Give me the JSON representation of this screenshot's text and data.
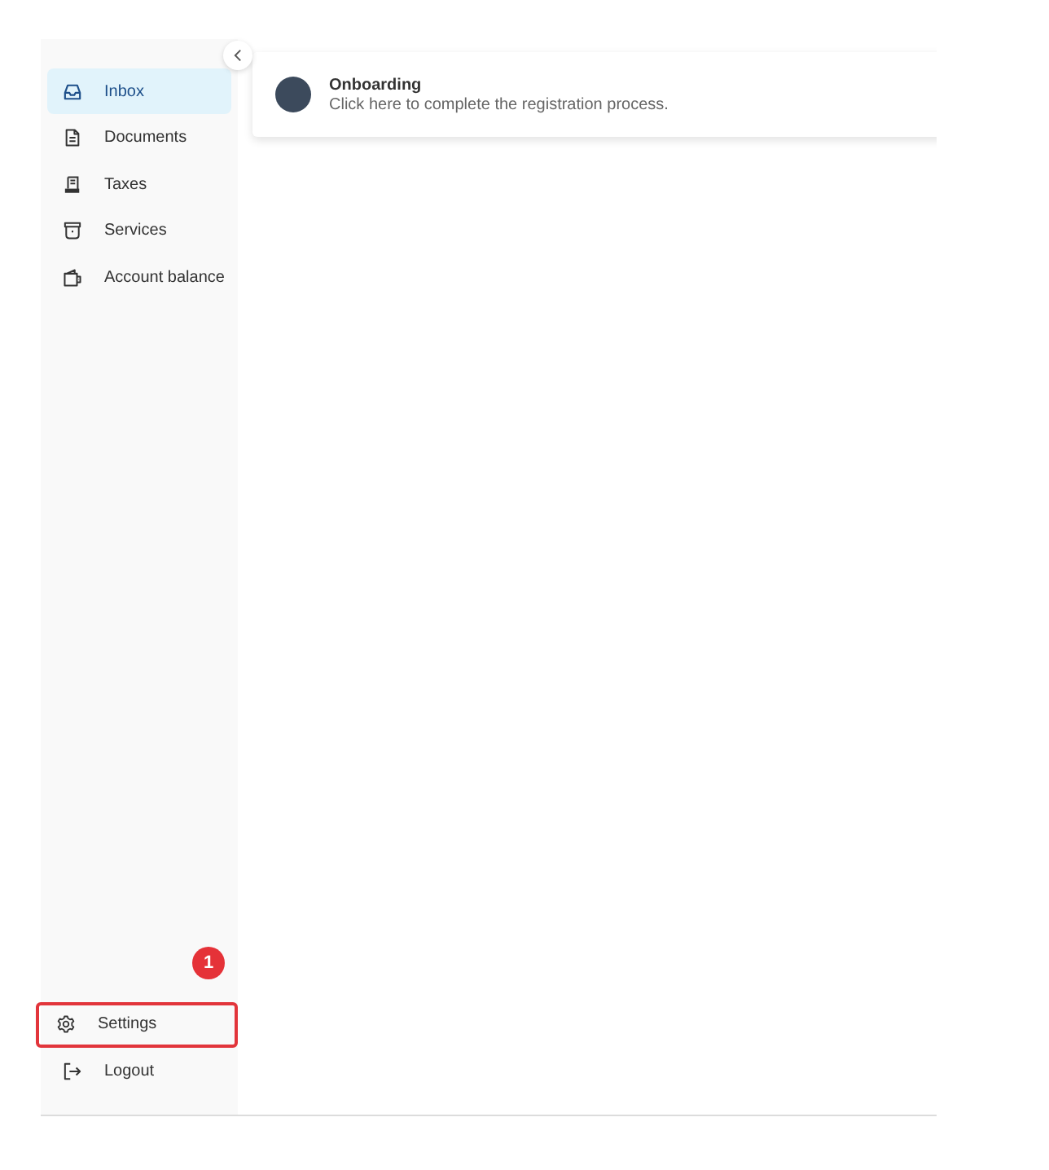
{
  "sidebar": {
    "nav_items": [
      {
        "label": "Inbox",
        "selected": true
      },
      {
        "label": "Documents",
        "selected": false
      },
      {
        "label": "Taxes",
        "selected": false
      },
      {
        "label": "Services",
        "selected": false
      },
      {
        "label": "Account balance",
        "selected": false
      }
    ],
    "bottom_items": [
      {
        "label": "Settings",
        "selected": false,
        "highlighted": true
      },
      {
        "label": "Logout",
        "selected": false,
        "highlighted": false
      }
    ]
  },
  "callout": {
    "label": "1"
  },
  "notification": {
    "title": "Onboarding",
    "text": "Click here to complete the registration process."
  }
}
